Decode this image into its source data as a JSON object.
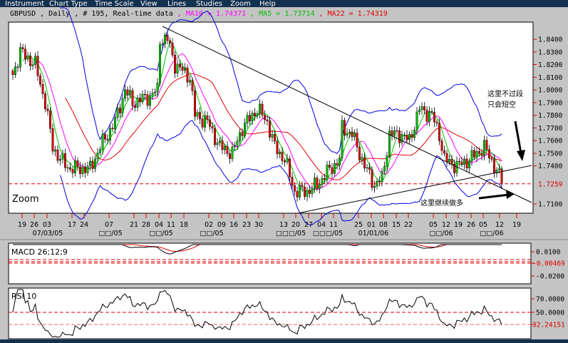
{
  "menu": [
    "Instrument",
    "Chart Type",
    "Time Scale",
    "View",
    "Lines",
    "Studies",
    "Zoom",
    "Help"
  ],
  "info": {
    "symbol_line": "GBPUSD , Daily , # 195, Real-time data",
    "ma10": " , MA10 = 1.74371",
    "ma5": " , MA5 = 1.73714",
    "ma22": " , MA22 = 1.74319"
  },
  "colors": {
    "ma10": "#ff00ff",
    "ma5": "#00c000",
    "ma22": "#e00000",
    "bollinger": "#0000e0",
    "up": "#00c000",
    "down": "#e00000"
  },
  "chart_label": "Zoom",
  "annotations": {
    "top": [
      "这里不过段",
      "只会短空"
    ],
    "bottom": "这里继续做多"
  },
  "chart_data": {
    "type": "candlestick",
    "price_axis": {
      "labels": [
        "1.8400",
        "1.8300",
        "1.8200",
        "1.8100",
        "1.8000",
        "1.7900",
        "1.7800",
        "1.7700",
        "1.7600",
        "1.7500",
        "1.7400",
        "1.7100"
      ],
      "range": [
        1.705,
        1.85
      ]
    },
    "current_price": "1.7259",
    "bar_count": 197,
    "close_path": [
      [
        0,
        1.812
      ],
      [
        3,
        1.83
      ],
      [
        9,
        1.82
      ],
      [
        13,
        1.79
      ],
      [
        16,
        1.755
      ],
      [
        19,
        1.745
      ],
      [
        23,
        1.738
      ],
      [
        31,
        1.738
      ],
      [
        35,
        1.755
      ],
      [
        41,
        1.775
      ],
      [
        45,
        1.8
      ],
      [
        48,
        1.79
      ],
      [
        55,
        1.795
      ],
      [
        58,
        1.8
      ],
      [
        59,
        1.84
      ],
      [
        62,
        1.84
      ],
      [
        65,
        1.82
      ],
      [
        71,
        1.81
      ],
      [
        73,
        1.78
      ],
      [
        78,
        1.775
      ],
      [
        83,
        1.755
      ],
      [
        88,
        1.75
      ],
      [
        92,
        1.77
      ],
      [
        98,
        1.785
      ],
      [
        102,
        1.775
      ],
      [
        105,
        1.755
      ],
      [
        109,
        1.745
      ],
      [
        113,
        1.72
      ],
      [
        118,
        1.72
      ],
      [
        122,
        1.725
      ],
      [
        126,
        1.735
      ],
      [
        131,
        1.745
      ],
      [
        132,
        1.77
      ],
      [
        136,
        1.765
      ],
      [
        141,
        1.74
      ],
      [
        145,
        1.725
      ],
      [
        148,
        1.73
      ],
      [
        151,
        1.765
      ],
      [
        155,
        1.765
      ],
      [
        159,
        1.76
      ],
      [
        163,
        1.785
      ],
      [
        168,
        1.78
      ],
      [
        171,
        1.765
      ],
      [
        173,
        1.745
      ],
      [
        178,
        1.74
      ],
      [
        183,
        1.745
      ],
      [
        189,
        1.755
      ],
      [
        193,
        1.74
      ],
      [
        196,
        1.728
      ]
    ],
    "date_ticks": [
      "19",
      "26",
      "03",
      "17",
      "24",
      "07",
      "21",
      "28",
      "04",
      "11",
      "18",
      "02",
      "09",
      "16",
      "23",
      "30",
      "13",
      "20",
      "27",
      "04",
      "11",
      "25",
      "01",
      "08",
      "15",
      "22",
      "05",
      "12",
      "19",
      "26",
      "05",
      "12",
      "19"
    ],
    "month_labels": [
      "07/03/05",
      "□□/05",
      "□□/05",
      "□□/05",
      "□□□/05",
      "□□□/05",
      "01/01/06",
      "□□/06",
      "□□/06"
    ],
    "macd": {
      "title": "MACD 26;12;9",
      "labels": [
        "0.0100",
        "-0.00469",
        "-0.0200"
      ]
    },
    "rsi": {
      "title": "RSI 10",
      "labels": [
        "70.0000",
        "50.0000",
        "32.24151"
      ]
    }
  }
}
